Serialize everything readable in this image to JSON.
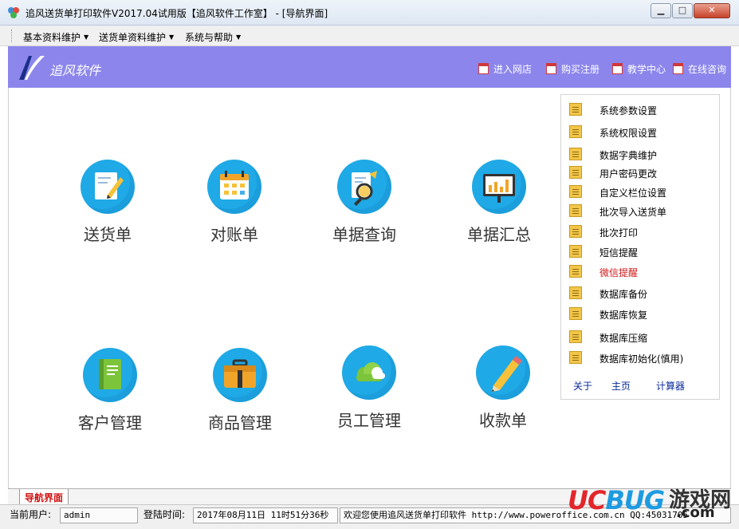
{
  "window": {
    "title": "追风送货单打印软件V2017.04试用版【追风软件工作室】 - [导航界面]",
    "controls": {
      "minimize": "▁",
      "maximize": "□",
      "close": "✕"
    }
  },
  "menubar": {
    "items": [
      {
        "label": "基本资料维护"
      },
      {
        "label": "送货单资料维护"
      },
      {
        "label": "系统与帮助"
      }
    ]
  },
  "banner": {
    "logo_text": "追风软件",
    "links": [
      {
        "label": "进入网店",
        "icon": "calendar-icon"
      },
      {
        "label": "购买注册",
        "icon": "calendar-icon"
      },
      {
        "label": "教学中心",
        "icon": "calendar-icon"
      },
      {
        "label": "在线咨询",
        "icon": "calendar-icon"
      }
    ]
  },
  "tiles": [
    {
      "label": "送货单",
      "icon": "delivery-note-icon"
    },
    {
      "label": "对账单",
      "icon": "calendar-icon"
    },
    {
      "label": "单据查询",
      "icon": "search-icon"
    },
    {
      "label": "单据汇总",
      "icon": "chart-board-icon"
    },
    {
      "label": "客户管理",
      "icon": "notebook-icon"
    },
    {
      "label": "商品管理",
      "icon": "briefcase-icon"
    },
    {
      "label": "员工管理",
      "icon": "cloud-icon"
    },
    {
      "label": "收款单",
      "icon": "pencil-icon"
    }
  ],
  "panel": {
    "items": [
      {
        "label": "系统参数设置"
      },
      {
        "label": "系统权限设置"
      },
      {
        "label": "数据字典维护"
      },
      {
        "label": "用户密码更改"
      },
      {
        "label": "自定义栏位设置"
      },
      {
        "label": "批次导入送货单"
      },
      {
        "label": "批次打印"
      },
      {
        "label": "短信提醒"
      },
      {
        "label": "微信提醒"
      },
      {
        "label": "数据库备份"
      },
      {
        "label": "数据库恢复"
      },
      {
        "label": "数据库压缩"
      },
      {
        "label": "数据库初始化(慎用)"
      }
    ],
    "highlight_color": "#d11a1a",
    "links": [
      {
        "label": "关于"
      },
      {
        "label": "主页"
      },
      {
        "label": "计算器"
      }
    ]
  },
  "tabs": {
    "active": "导航界面"
  },
  "status": {
    "user_label": "当前用户:",
    "user_value": "admin",
    "login_label": "登陆时间:",
    "login_value": "2017年08月11日 11时51分36秒",
    "welcome": "欢迎您使用追风送货单打印软件 http://www.poweroffice.com.cn QQ:45031705"
  },
  "watermark": {
    "uc": "UC",
    "bug": "BUG",
    "yx": "游戏网",
    "com": ".com"
  },
  "colors": {
    "banner": "#8c86ec",
    "tile": "#1fa9e6",
    "accent_red": "#d01010"
  }
}
